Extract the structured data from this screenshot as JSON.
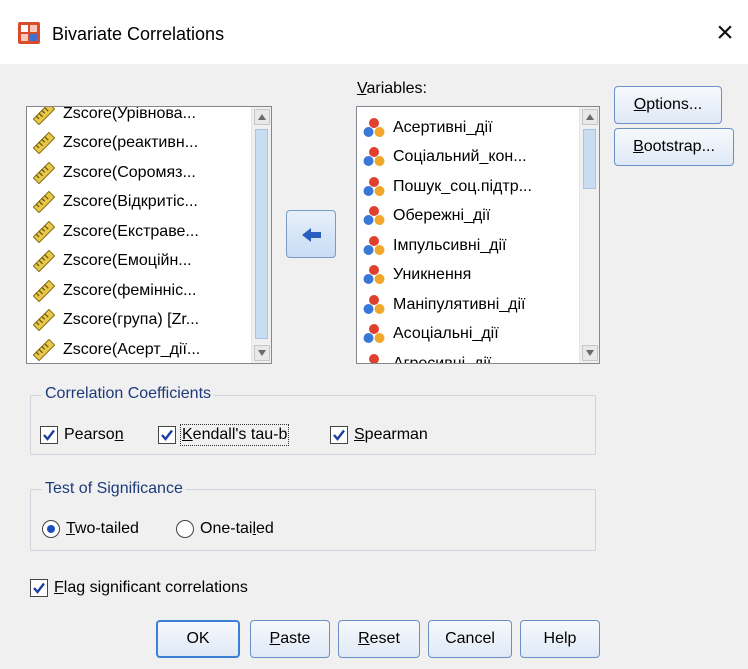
{
  "window": {
    "title": "Bivariate Correlations",
    "close_glyph": "×"
  },
  "source_list": {
    "items": [
      {
        "label": "Zscore(Урівнова..."
      },
      {
        "label": "Zscore(реактивн..."
      },
      {
        "label": "Zscore(Соромяз..."
      },
      {
        "label": "Zscore(Відкритіс..."
      },
      {
        "label": "Zscore(Екстраве..."
      },
      {
        "label": "Zscore(Емоційн..."
      },
      {
        "label": "Zscore(фемінніс..."
      },
      {
        "label": "Zscore(група) [Zr..."
      },
      {
        "label": "Zscore(Асерт_дії..."
      }
    ],
    "icon": "ruler-scale-icon"
  },
  "variables": {
    "label_pre": "",
    "label_u": "V",
    "label_post": "ariables:",
    "items": [
      {
        "label": "Асертивні_дії"
      },
      {
        "label": "Соціальний_кон..."
      },
      {
        "label": "Пошук_соц.підтр..."
      },
      {
        "label": "Обережні_дії"
      },
      {
        "label": "Імпульсивні_дії"
      },
      {
        "label": "Уникнення"
      },
      {
        "label": "Маніпулятивні_дії"
      },
      {
        "label": "Асоціальні_дії"
      },
      {
        "label": "Агресивні_дії"
      }
    ],
    "icon": "nominal-variable-icon"
  },
  "side_buttons": {
    "options": {
      "pre": "",
      "u": "O",
      "post": "ptions..."
    },
    "bootstrap": {
      "pre": "",
      "u": "B",
      "post": "ootstrap..."
    }
  },
  "correlation_coefficients": {
    "legend": "Correlation Coefficients",
    "pearson": {
      "pre": "Pearso",
      "u": "n",
      "post": "",
      "checked": true
    },
    "kendall": {
      "pre": "",
      "u": "K",
      "post": "endall's tau-b",
      "checked": true
    },
    "spearman": {
      "pre": "",
      "u": "S",
      "post": "pearman",
      "checked": true
    }
  },
  "test_of_significance": {
    "legend": "Test of Significance",
    "two_tailed": {
      "pre": "",
      "u": "T",
      "post": "wo-tailed",
      "selected": true
    },
    "one_tailed": {
      "pre": "One-tai",
      "u": "l",
      "post": "ed",
      "selected": false
    }
  },
  "flag": {
    "pre": "",
    "u": "F",
    "post": "lag significant correlations",
    "checked": true
  },
  "bottom_buttons": {
    "ok": {
      "pre": "OK",
      "u": "",
      "post": ""
    },
    "paste": {
      "pre": "",
      "u": "P",
      "post": "aste"
    },
    "reset": {
      "pre": "",
      "u": "R",
      "post": "eset"
    },
    "cancel": {
      "pre": "Cancel",
      "u": "",
      "post": ""
    },
    "help": {
      "pre": "Help",
      "u": "",
      "post": ""
    }
  },
  "colors": {
    "accent": "#3c7fd6",
    "button_border": "#6b8fc7",
    "background": "#f0f0f0"
  }
}
